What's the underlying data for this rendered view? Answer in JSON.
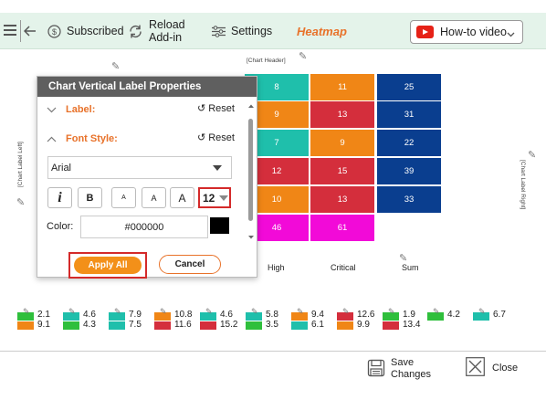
{
  "toolbar": {
    "subscribed_label": "Subscribed",
    "reload_line1": "Reload",
    "reload_line2": "Add-in",
    "settings_label": "Settings",
    "heatmap_title": "Heatmap",
    "howto_label": "How-to video"
  },
  "chart": {
    "header": "[Chart Header]",
    "label_left": "[Chart Label Left]",
    "label_right": "[Chart Label Right]",
    "column_labels": [
      "High",
      "Critical",
      "Sum"
    ],
    "rows": [
      [
        {
          "v": "8",
          "c": "#1fbfab"
        },
        {
          "v": "11",
          "c": "#f08616"
        },
        {
          "v": "25",
          "c": "#0a3e8f"
        }
      ],
      [
        {
          "v": "9",
          "c": "#f08616"
        },
        {
          "v": "13",
          "c": "#d42e3c"
        },
        {
          "v": "31",
          "c": "#0a3e8f"
        }
      ],
      [
        {
          "v": "7",
          "c": "#1fbfab"
        },
        {
          "v": "9",
          "c": "#f08616"
        },
        {
          "v": "22",
          "c": "#0a3e8f"
        }
      ],
      [
        {
          "v": "12",
          "c": "#d42e3c"
        },
        {
          "v": "15",
          "c": "#d42e3c"
        },
        {
          "v": "39",
          "c": "#0a3e8f"
        }
      ],
      [
        {
          "v": "10",
          "c": "#f08616"
        },
        {
          "v": "13",
          "c": "#d42e3c"
        },
        {
          "v": "33",
          "c": "#0a3e8f"
        }
      ],
      [
        {
          "v": "46",
          "c": "#f20ad8"
        },
        {
          "v": "61",
          "c": "#f20ad8"
        },
        null
      ]
    ]
  },
  "legend": [
    {
      "top": "2.1",
      "bottom": "9.1",
      "c1": "#2fbf3c",
      "c2": "#f08616"
    },
    {
      "top": "4.6",
      "bottom": "4.3",
      "c1": "#1fbfab",
      "c2": "#2fbf3c"
    },
    {
      "top": "7.9",
      "bottom": "7.5",
      "c1": "#1fbfab",
      "c2": "#1fbfab"
    },
    {
      "top": "10.8",
      "bottom": "11.6",
      "c1": "#f08616",
      "c2": "#d42e3c"
    },
    {
      "top": "4.6",
      "bottom": "15.2",
      "c1": "#1fbfab",
      "c2": "#d42e3c"
    },
    {
      "top": "5.8",
      "bottom": "3.5",
      "c1": "#1fbfab",
      "c2": "#2fbf3c"
    },
    {
      "top": "9.4",
      "bottom": "6.1",
      "c1": "#f08616",
      "c2": "#1fbfab"
    },
    {
      "top": "12.6",
      "bottom": "9.9",
      "c1": "#d42e3c",
      "c2": "#f08616"
    },
    {
      "top": "1.9",
      "bottom": "13.4",
      "c1": "#2fbf3c",
      "c2": "#d42e3c"
    },
    {
      "top": "4.2",
      "bottom": "",
      "c1": "#2fbf3c",
      "c2": ""
    },
    {
      "top": "6.7",
      "bottom": "",
      "c1": "#1fbfab",
      "c2": ""
    }
  ],
  "dialog": {
    "title": "Chart Vertical Label Properties",
    "label_section": "Label:",
    "font_section": "Font Style:",
    "reset_label": "Reset",
    "font_family": "Arial",
    "italic_glyph": "i",
    "bold_glyph": "B",
    "size_small_glyph": "A",
    "size_medium_glyph": "A",
    "size_large_glyph": "A",
    "font_size": "12",
    "color_label": "Color:",
    "color_value": "#000000",
    "color_swatch": "#000000",
    "apply_label": "Apply All",
    "cancel_label": "Cancel"
  },
  "footer": {
    "save_line1": "Save",
    "save_line2": "Changes",
    "close_label": "Close"
  }
}
